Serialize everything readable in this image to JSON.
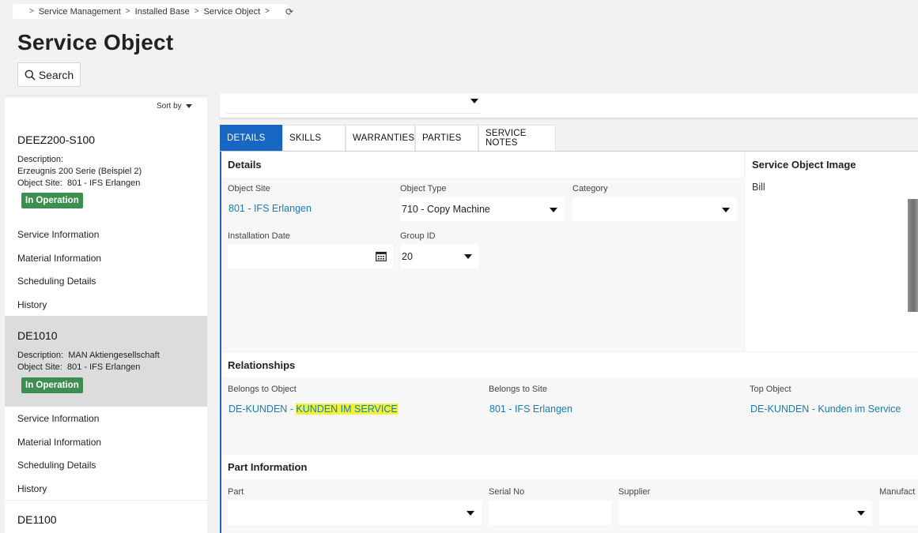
{
  "breadcrumb": {
    "items": [
      "Service Management",
      "Installed Base",
      "Service Object"
    ]
  },
  "page": {
    "title": "Service Object",
    "search_label": "Search"
  },
  "list": {
    "sort_label": "Sort by",
    "cards": [
      {
        "id": "DEEZ200-S100",
        "description_label": "Description:",
        "description_value": "Erzeugnis 200 Serie (Beispiel 2)",
        "site_label": "Object Site:",
        "site_value": "801 - IFS Erlangen",
        "status": "In Operation",
        "links": [
          "Service Information",
          "Material Information",
          "Scheduling Details",
          "History"
        ]
      },
      {
        "id": "DE1010",
        "description_label": "Description:",
        "description_value": "MAN Aktiengesellschaft",
        "site_label": "Object Site:",
        "site_value": "801 - IFS Erlangen",
        "status": "In Operation",
        "links": [
          "Service Information",
          "Material Information",
          "Scheduling Details",
          "History"
        ]
      },
      {
        "id": "DE1100"
      }
    ]
  },
  "tabs": [
    "DETAILS",
    "SKILLS",
    "WARRANTIES",
    "PARTIES",
    "SERVICE NOTES"
  ],
  "details": {
    "heading": "Details",
    "object_site_label": "Object Site",
    "object_site_value": "801 - IFS Erlangen",
    "object_type_label": "Object Type",
    "object_type_value": "710 - Copy Machine",
    "category_label": "Category",
    "category_value": "",
    "installation_date_label": "Installation Date",
    "installation_date_value": "",
    "group_id_label": "Group ID",
    "group_id_value": "20"
  },
  "image_panel": {
    "heading": "Service Object Image",
    "caption": "Bill"
  },
  "relationships": {
    "heading": "Relationships",
    "belongs_to_object_label": "Belongs to Object",
    "belongs_to_object_prefix": "DE-KUNDEN - ",
    "belongs_to_object_highlight": "KUNDEN IM SERVICE",
    "belongs_to_site_label": "Belongs to Site",
    "belongs_to_site_value": "801 - IFS Erlangen",
    "top_object_label": "Top Object",
    "top_object_value": "DE-KUNDEN - Kunden im Service"
  },
  "part_info": {
    "heading": "Part Information",
    "part_label": "Part",
    "serial_label": "Serial No",
    "supplier_label": "Supplier",
    "manufacturer_label": "Manufact"
  },
  "colors": {
    "accent": "#1766c2",
    "status_green": "#3d8f51",
    "link": "#1a7bb8",
    "highlight": "#eef23a"
  }
}
